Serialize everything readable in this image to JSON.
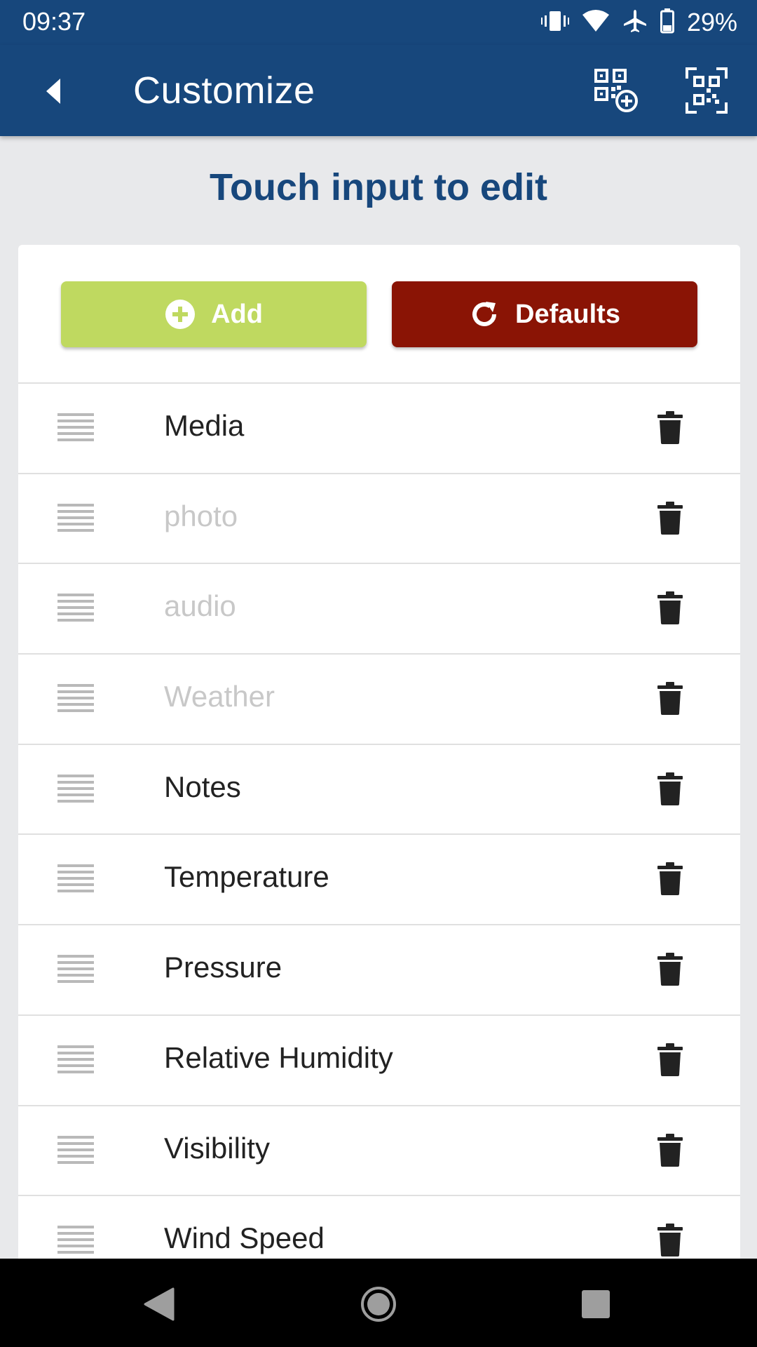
{
  "status_bar": {
    "time": "09:37",
    "battery_percent": "29%",
    "icons": [
      "vibrate-icon",
      "wifi-icon",
      "airplane-icon",
      "battery-icon"
    ]
  },
  "app_bar": {
    "title": "Customize",
    "actions": [
      "qr-add-icon",
      "qr-scan-icon"
    ]
  },
  "heading": "Touch input to edit",
  "buttons": {
    "add_label": "Add",
    "defaults_label": "Defaults"
  },
  "colors": {
    "primary": "#17477c",
    "add": "#bfd960",
    "defaults": "#8a1405"
  },
  "items": [
    {
      "label": "Media",
      "placeholder": false
    },
    {
      "label": "photo",
      "placeholder": true
    },
    {
      "label": "audio",
      "placeholder": true
    },
    {
      "label": "Weather",
      "placeholder": true
    },
    {
      "label": "Notes",
      "placeholder": false
    },
    {
      "label": "Temperature",
      "placeholder": false
    },
    {
      "label": "Pressure",
      "placeholder": false
    },
    {
      "label": "Relative Humidity",
      "placeholder": false
    },
    {
      "label": "Visibility",
      "placeholder": false
    },
    {
      "label": "Wind Speed",
      "placeholder": false
    }
  ]
}
